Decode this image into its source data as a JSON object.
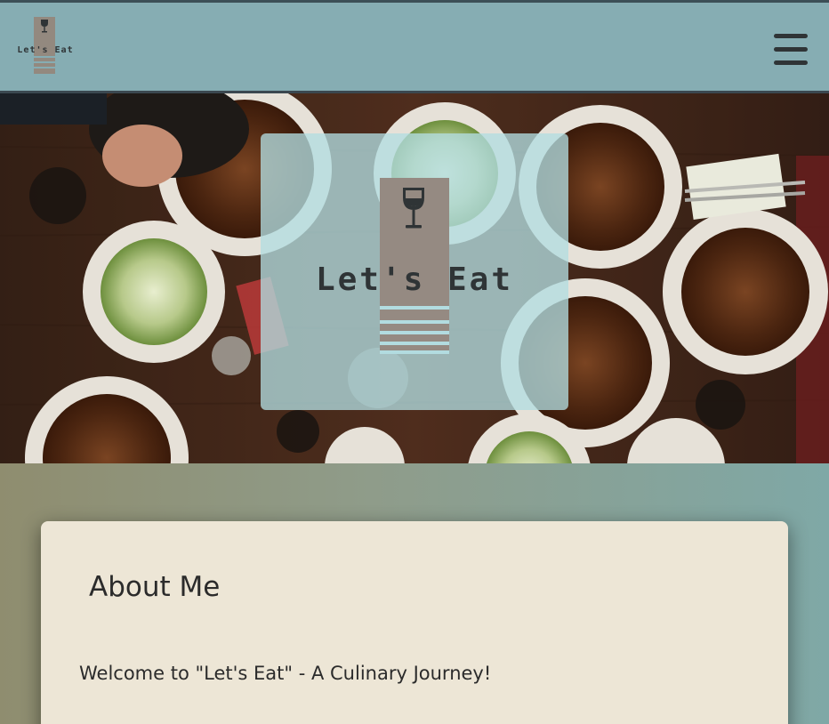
{
  "header": {
    "logo_text": "Let's Eat",
    "menu_icon": "hamburger-menu-icon",
    "background_color": "#86adb3"
  },
  "hero": {
    "image": "food-table-photo",
    "logo_icon": "wine-glass-icon",
    "title": "Let's Eat"
  },
  "about": {
    "title": "About Me",
    "subtitle": "Welcome to \"Let's Eat\" - A Culinary Journey!"
  },
  "colors": {
    "card_background": "#ede6d6",
    "text": "#2f3436",
    "logo_block": "#958a82"
  }
}
